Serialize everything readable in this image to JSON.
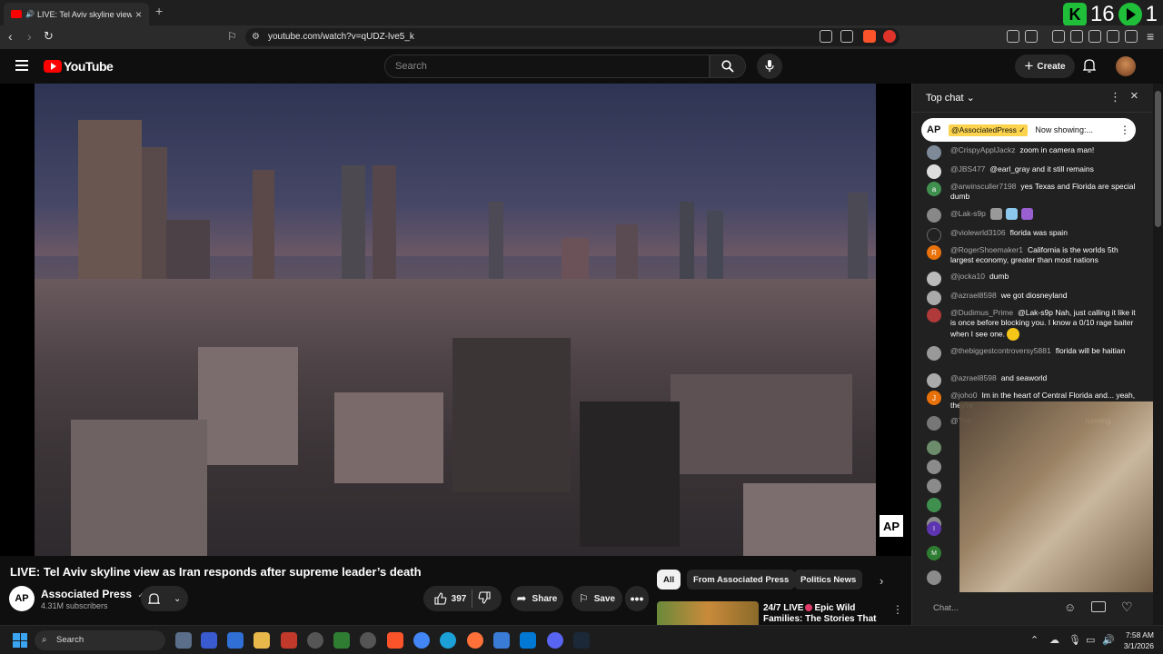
{
  "browser": {
    "tab_title": "LIVE: Tel Aviv skyline view as I",
    "url": "youtube.com/watch?v=qUDZ-lve5_k",
    "overlay_counter": "16",
    "overlay_counter_2": "1"
  },
  "youtube": {
    "logo_text": "YouTube",
    "search_placeholder": "Search",
    "create_label": "Create"
  },
  "video": {
    "title": "LIVE: Tel Aviv skyline view as Iran responds after supreme leader’s death",
    "watermark": "AP",
    "channel_avatar": "AP",
    "channel_name": "Associated Press",
    "channel_verified": "✓",
    "subscribers": "4.31M subscribers",
    "likes": "397",
    "share_label": "Share",
    "save_label": "Save"
  },
  "related": {
    "chips": [
      "All",
      "From Associated Press",
      "Politics News"
    ],
    "item_title_1": "24/7 LIVE",
    "item_title_2": "Epic Wild",
    "item_title_3": "Families: The Stories That ..."
  },
  "chat": {
    "header": "Top chat",
    "pinned_logo": "AP",
    "pinned_author": "@AssociatedPress ✓",
    "pinned_text": "Now showing:...",
    "input_placeholder": "Chat...",
    "messages": [
      {
        "avatar": "",
        "author": "@CrispyApplJackz",
        "text": "zoom in camera man!"
      },
      {
        "avatar": "",
        "author": "@JBS477",
        "text": "@earl_gray and it still remains"
      },
      {
        "avatar": "a",
        "author": "@arwinsculler7198",
        "text": "yes Texas and Florida are special dumb"
      },
      {
        "avatar": "",
        "author": "@Lak-s9p",
        "text": ""
      },
      {
        "avatar": "",
        "author": "@violewrld3106",
        "text": "florida was spain"
      },
      {
        "avatar": "R",
        "author": "@RogerShoemaker1",
        "text": "California is the worlds 5th largest economy, greater than most nations"
      },
      {
        "avatar": "",
        "author": "@jocka10",
        "text": "dumb"
      },
      {
        "avatar": "",
        "author": "@azrael8598",
        "text": "we got diosneyland"
      },
      {
        "avatar": "",
        "author": "@Dudimus_Prime",
        "text": "@Lak-s9p Nah, just calling it like it is once before blocking you. I know a 0/10 rage baiter when I see one."
      },
      {
        "avatar": "",
        "author": "@thebiggestcontroversy5881",
        "text": "florida will be haitian"
      },
      {
        "avatar": "",
        "author": "@azrael8598",
        "text": "and seaworld"
      },
      {
        "avatar": "J",
        "author": "@joho0",
        "text": "Im in the heart of Central Florida and... yeah, they're"
      },
      {
        "avatar": "",
        "author": "@The",
        "text": "running"
      }
    ],
    "lower_avatars": [
      "",
      "",
      "",
      "",
      "",
      "I",
      "M",
      ""
    ]
  },
  "taskbar": {
    "search_label": "Search",
    "time": "7:58 AM",
    "date": "3/1/2026"
  },
  "colors": {
    "youtube_red": "#ff0000",
    "page_bg": "#0f0f0f",
    "chat_bg": "#212121",
    "moderator_badge": "#fcd34d"
  }
}
